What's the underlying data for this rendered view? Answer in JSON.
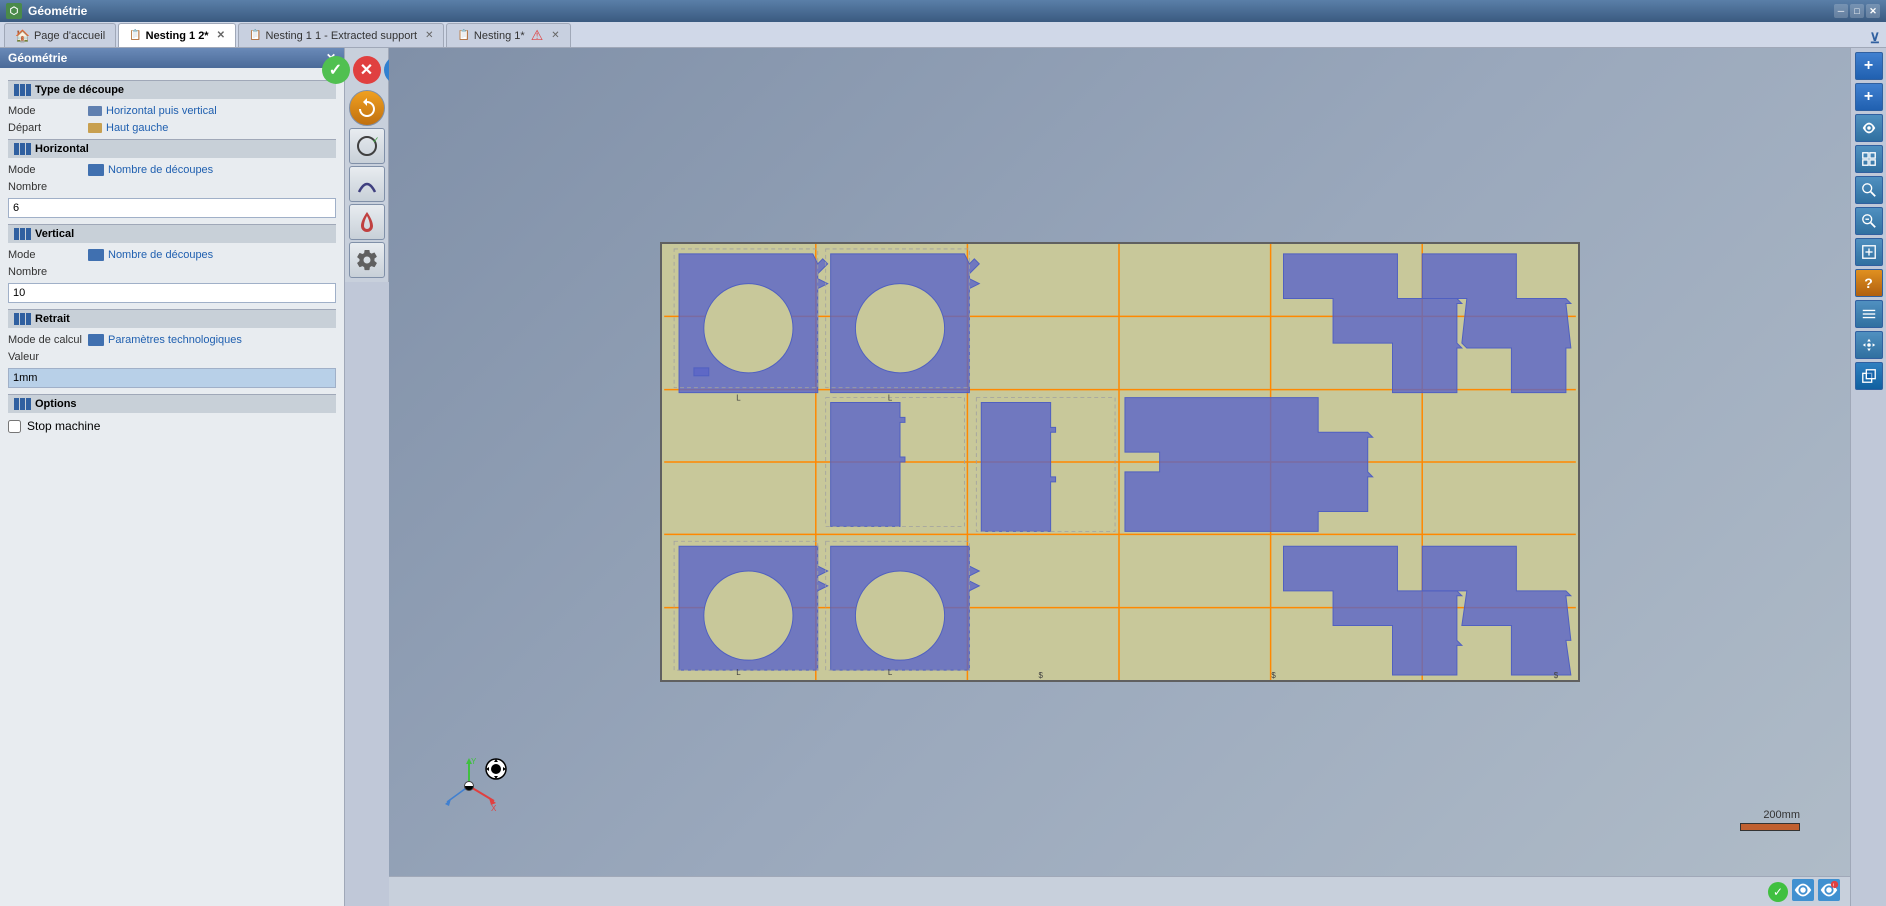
{
  "app": {
    "title": "Géométrie",
    "title_icon": "⬡"
  },
  "tabs": [
    {
      "id": "home",
      "label": "Page d'accueil",
      "icon": "🏠",
      "active": false,
      "closable": false
    },
    {
      "id": "nesting2",
      "label": "Nesting 1 2*",
      "icon": "📋",
      "active": true,
      "closable": true
    },
    {
      "id": "nesting1extracted",
      "label": "Nesting 1 1 - Extracted support",
      "icon": "📋",
      "active": false,
      "closable": true
    },
    {
      "id": "nesting1",
      "label": "Nesting 1*",
      "icon": "📋",
      "active": false,
      "closable": true
    }
  ],
  "left_panel": {
    "title": "Géométrie",
    "sections": {
      "type_decoupe": {
        "header": "Type de découpe",
        "fields": [
          {
            "label": "Mode",
            "value": "Horizontal puis vertical",
            "icon": true
          },
          {
            "label": "Départ",
            "value": "Haut gauche",
            "icon": true
          }
        ]
      },
      "horizontal": {
        "header": "Horizontal",
        "fields": [
          {
            "label": "Mode",
            "value": "Nombre de découpes",
            "icon": true
          },
          {
            "label": "Nombre",
            "value": "6",
            "input": true
          }
        ]
      },
      "vertical": {
        "header": "Vertical",
        "fields": [
          {
            "label": "Mode",
            "value": "Nombre de découpes",
            "icon": true
          },
          {
            "label": "Nombre",
            "value": "10",
            "input": true
          }
        ]
      },
      "retrait": {
        "header": "Retrait",
        "fields": [
          {
            "label": "Mode de calcul",
            "value": "Paramètres technologiques",
            "icon": true
          },
          {
            "label": "Valeur",
            "value": "1mm",
            "input": true,
            "highlighted": true
          }
        ]
      },
      "options": {
        "header": "Options",
        "fields": [
          {
            "label": "Stop machine",
            "checkbox": true,
            "checked": false
          }
        ]
      }
    }
  },
  "action_buttons": {
    "check": "✓",
    "cross": "✕",
    "question": "?"
  },
  "toolbar_buttons": [
    {
      "id": "arrow",
      "icon": "↩",
      "tooltip": "Undo"
    },
    {
      "id": "circle-check",
      "icon": "⊙",
      "tooltip": "Validate"
    },
    {
      "id": "curve",
      "icon": "∿",
      "tooltip": "Curve"
    },
    {
      "id": "flame",
      "icon": "🔥",
      "tooltip": "Cut"
    },
    {
      "id": "settings",
      "icon": "⚙",
      "tooltip": "Settings"
    }
  ],
  "right_toolbar_buttons": [
    {
      "id": "plus1",
      "icon": "+",
      "color": "blue",
      "tooltip": "Add"
    },
    {
      "id": "plus2",
      "icon": "+",
      "color": "blue",
      "tooltip": "Add H"
    },
    {
      "id": "view",
      "icon": "👁",
      "color": "blue",
      "tooltip": "View"
    },
    {
      "id": "grid",
      "icon": "⊞",
      "color": "blue",
      "tooltip": "Grid"
    },
    {
      "id": "search",
      "icon": "🔍",
      "color": "blue",
      "tooltip": "Search"
    },
    {
      "id": "search2",
      "icon": "🔍",
      "color": "blue",
      "tooltip": "Search+"
    },
    {
      "id": "zoom-fit",
      "icon": "⊕",
      "color": "blue",
      "tooltip": "Fit"
    },
    {
      "id": "question",
      "icon": "?",
      "color": "orange",
      "tooltip": "Help"
    },
    {
      "id": "list",
      "icon": "≡",
      "color": "blue",
      "tooltip": "List"
    },
    {
      "id": "move",
      "icon": "↔",
      "color": "blue",
      "tooltip": "Move"
    },
    {
      "id": "blue-box",
      "icon": "▣",
      "color": "teal",
      "tooltip": "Box"
    }
  ],
  "scale": {
    "label": "200mm"
  },
  "status_bar": {
    "green_status": "✓",
    "icons": [
      "✓",
      "⊙",
      "⊙"
    ]
  }
}
